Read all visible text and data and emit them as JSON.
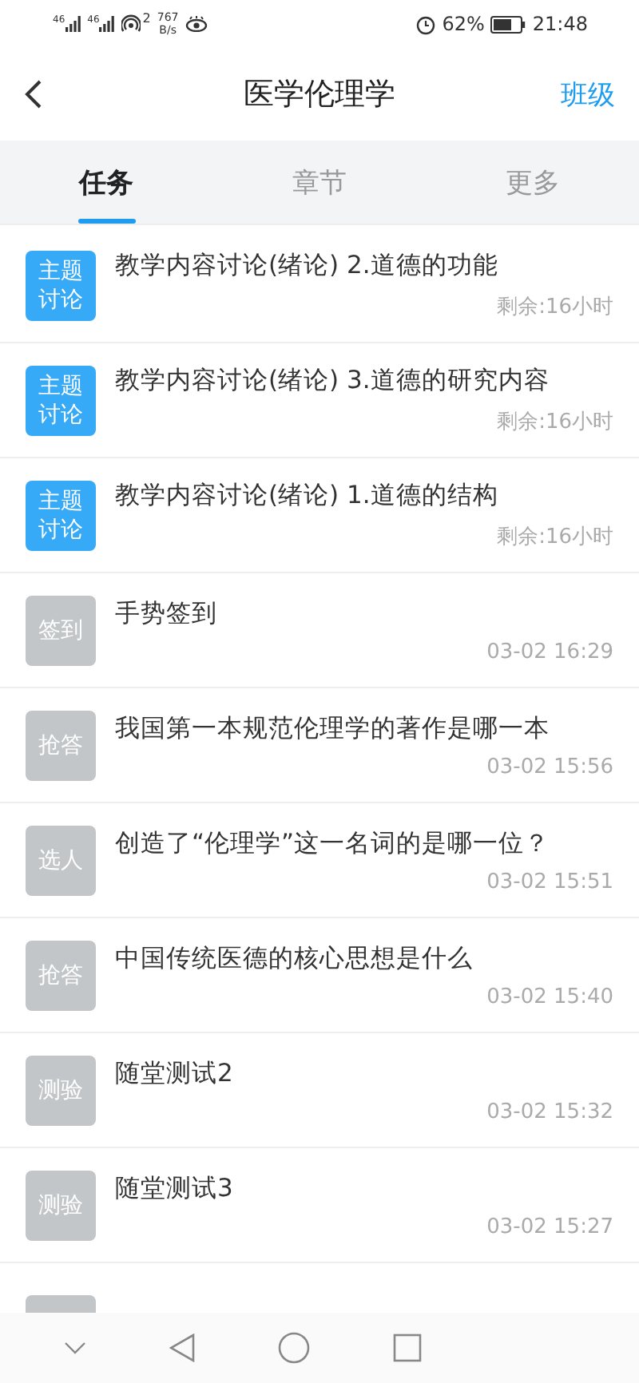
{
  "status_bar": {
    "networks": [
      "46",
      "46"
    ],
    "hotspot_count": "2",
    "speed": "767",
    "speed_unit": "B/s",
    "battery": "62%",
    "time": "21:48"
  },
  "header": {
    "title": "医学伦理学",
    "action": "班级"
  },
  "tabs": [
    {
      "label": "任务",
      "selected": true
    },
    {
      "label": "章节",
      "selected": false
    },
    {
      "label": "更多",
      "selected": false
    }
  ],
  "tasks": [
    {
      "badge": "主题讨论",
      "title": "教学内容讨论(绪论) 2.道德的功能",
      "meta": "剩余:16小时",
      "active": true
    },
    {
      "badge": "主题讨论",
      "title": "教学内容讨论(绪论)  3.道德的研究内容",
      "meta": "剩余:16小时",
      "active": true
    },
    {
      "badge": "主题讨论",
      "title": "教学内容讨论(绪论) 1.道德的结构",
      "meta": "剩余:16小时",
      "active": true
    },
    {
      "badge": "签到",
      "title": "手势签到",
      "meta": "03-02 16:29",
      "active": false
    },
    {
      "badge": "抢答",
      "title": "我国第一本规范伦理学的著作是哪一本",
      "meta": "03-02 15:56",
      "active": false
    },
    {
      "badge": "选人",
      "title": "创造了“伦理学”这一名词的是哪一位？",
      "meta": "03-02 15:51",
      "active": false
    },
    {
      "badge": "抢答",
      "title": "中国传统医德的核心思想是什么",
      "meta": "03-02 15:40",
      "active": false
    },
    {
      "badge": "测验",
      "title": "随堂测试2",
      "meta": "03-02 15:32",
      "active": false
    },
    {
      "badge": "测验",
      "title": "随堂测试3",
      "meta": "03-02 15:27",
      "active": false
    }
  ]
}
